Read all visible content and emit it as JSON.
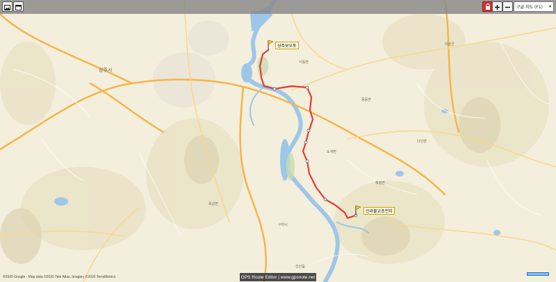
{
  "toolbar": {
    "map_type_selected": "구글 지도 (F1)"
  },
  "icons": {
    "left_1": "image-icon",
    "left_2": "window-icon",
    "lock": "lock-icon",
    "zoom_in": "plus-icon",
    "zoom_out": "minus-icon",
    "dropdown": "chevron-down-icon"
  },
  "map": {
    "start_label": "상주보오토",
    "end_label": "신라불교초전지",
    "places": {
      "sangju_si": "상주시",
      "neighborhood_1": "낙동면",
      "neighborhood_2": "중동면",
      "neighborhood_3": "의성군",
      "neighborhood_4": "도개면",
      "neighborhood_5": "옥성면",
      "neighborhood_6": "구미시",
      "neighborhood_7": "해평면",
      "neighborhood_8": "선산읍",
      "neighborhood_9": "다인면"
    },
    "route_color": "#e53935",
    "river_color": "#9ec6e8"
  },
  "footer": {
    "attribution": "©2020 Google - Map data ©2020 Tele Atlas, Imagery ©2020 TerraMetrics",
    "app_title": "GPS Route Editor | www.gpsnote.net"
  }
}
